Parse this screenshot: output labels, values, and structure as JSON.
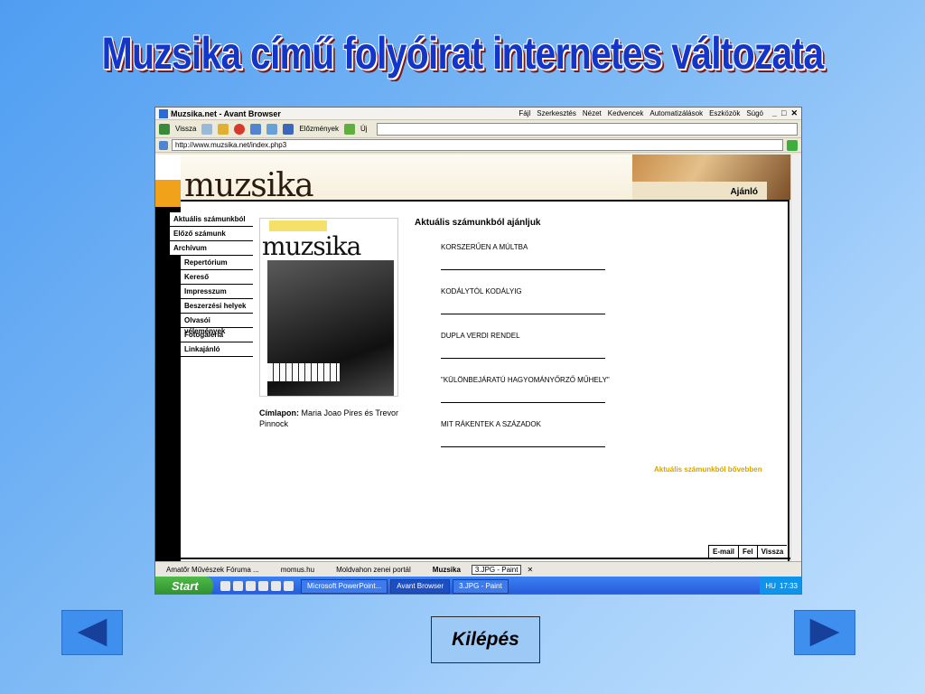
{
  "slide": {
    "title": "Muzsika című folyóirat internetes változata",
    "exit_label": "Kilépés"
  },
  "browser": {
    "title": "Muzsika.net - Avant Browser",
    "menu": [
      "Fájl",
      "Szerkesztés",
      "Nézet",
      "Kedvencek",
      "Automatizálások",
      "Eszközök",
      "Súgó"
    ],
    "toolbar": {
      "back_label": "Vissza",
      "history_label": "Előzmények",
      "new_label": "Új"
    },
    "address": "http://www.muzsika.net/index.php3",
    "tabs": [
      "Amatőr Művészek Fóruma ...",
      "momus.hu",
      "Moldvahon zenei portál",
      "Muzsika"
    ],
    "active_tab_popup": "3.JPG - Paint"
  },
  "site": {
    "logo": "muzsika",
    "recommend_label": "Ajánló",
    "nav": [
      {
        "label": "Aktuális számunkból",
        "sub": false
      },
      {
        "label": "Előző számunk",
        "sub": false
      },
      {
        "label": "Archívum",
        "sub": false
      },
      {
        "label": "Repertórium",
        "sub": true
      },
      {
        "label": "Kereső",
        "sub": true
      },
      {
        "label": "Impresszum",
        "sub": true
      },
      {
        "label": "Beszerzési helyek",
        "sub": true
      },
      {
        "label": "Olvasói vélemények",
        "sub": true
      },
      {
        "label": "Fotogaléria",
        "sub": true
      },
      {
        "label": "Linkajánló",
        "sub": true
      }
    ],
    "magazine_title": "muzsika",
    "caption_label": "Címlapon:",
    "caption_text": "Maria Joao Pires és Trevor Pinnock",
    "section_heading": "Aktuális számunkból ajánljuk",
    "articles": [
      "KORSZERŰEN A MÚLTBA",
      "KODÁLYTÓL KODÁLYIG",
      "DUPLA VERDI RENDEL",
      "\"KÜLÖNBEJÁRATÚ HAGYOMÁNYŐRZŐ MŰHELY\"",
      "MIT RÁKENTEK A SZÁZADOK"
    ],
    "more_link": "Aktuális számunkból bővebben",
    "footer_tabs": [
      "E-mail",
      "Fel",
      "Vissza"
    ]
  },
  "taskbar": {
    "start_label": "Start",
    "buttons": [
      "Microsoft PowerPoint...",
      "Avant Browser",
      "3.JPG - Paint"
    ],
    "lang": "HU",
    "time": "17:33"
  },
  "colors": {
    "title": "#1436c8",
    "accent_orange": "#f0a21a",
    "link_gold": "#d7a300",
    "nav_arrow": "#3f8fef"
  }
}
